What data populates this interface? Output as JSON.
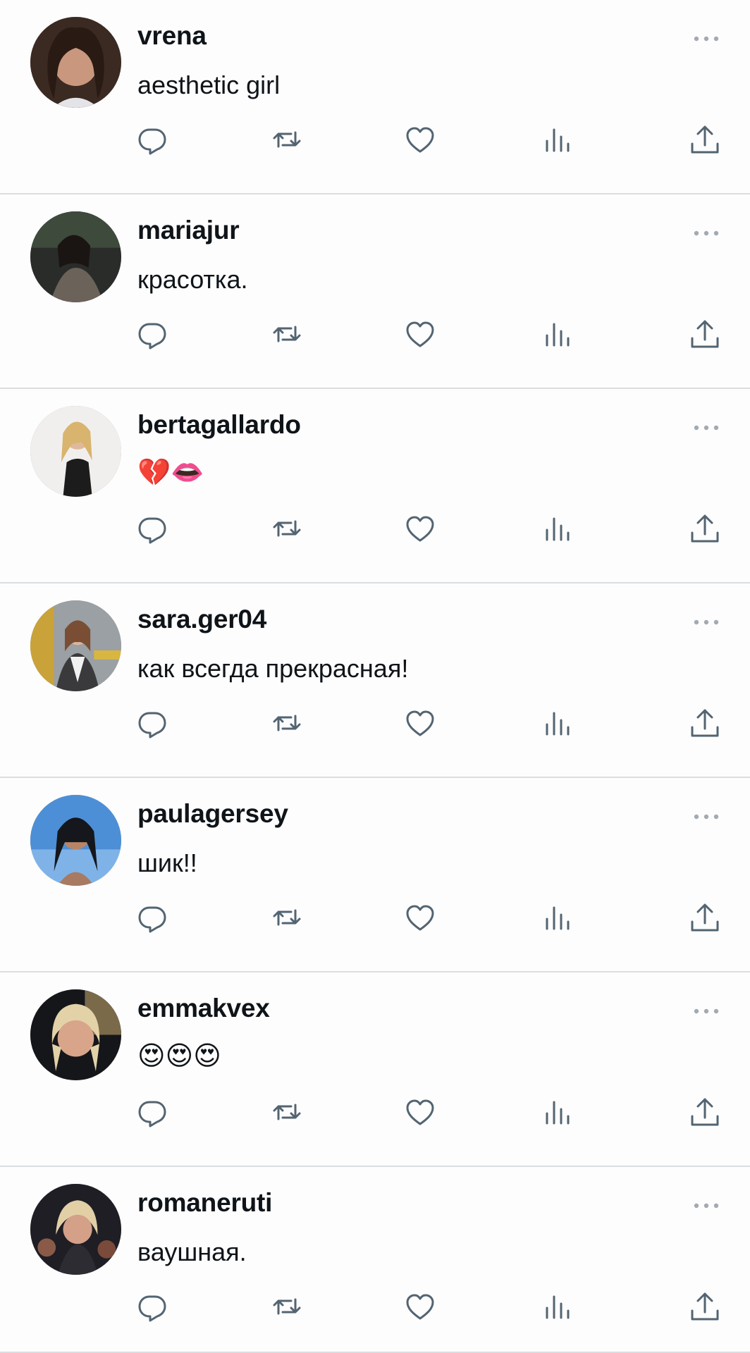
{
  "colors": {
    "text": "#0f1419",
    "icon": "#536471",
    "divider": "#dadde1",
    "background": "#fdfdfd"
  },
  "icons": {
    "more": "more-dots-icon",
    "reply": "reply-bubble-icon",
    "repost": "repost-arrows-icon",
    "like": "heart-icon",
    "views": "views-bars-icon",
    "share": "share-upload-icon"
  },
  "replies": [
    {
      "username": "vrena",
      "text": "aesthetic girl"
    },
    {
      "username": "mariajur",
      "text": "красотка."
    },
    {
      "username": "bertagallardo",
      "text": "💔👄"
    },
    {
      "username": "sara.ger04",
      "text": "как всегда прекрасная!"
    },
    {
      "username": "paulagersey",
      "text": "шик!!"
    },
    {
      "username": "emmakvex",
      "text": "😍😍😍"
    },
    {
      "username": "romaneruti",
      "text": "ваушная."
    }
  ]
}
